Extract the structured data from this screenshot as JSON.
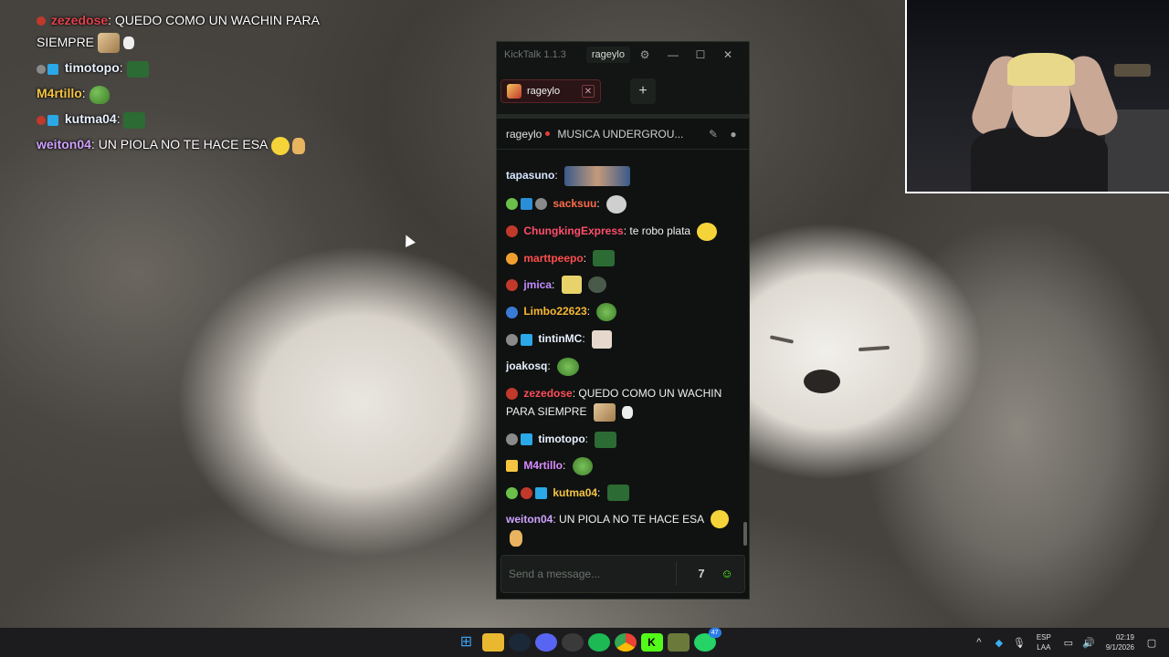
{
  "overlay_chat": [
    {
      "user": "zezedose",
      "user_color": "#e2424e",
      "text": "QUEDO COMO UN WACHIN PARA SIEMPRE"
    },
    {
      "user": "timotopo",
      "user_color": "#e8f0ff",
      "text": ""
    },
    {
      "user": "M4rtillo",
      "user_color": "#f5c542",
      "text": ""
    },
    {
      "user": "kutma04",
      "user_color": "#e8f0ff",
      "text": ""
    },
    {
      "user": "weiton04",
      "user_color": "#cfa2ff",
      "text": "UN PIOLA NO TE HACE ESA"
    }
  ],
  "kicktalk": {
    "app_title": "KickTalk 1.1.3",
    "current_user": "rageylo",
    "tab_label": "rageylo",
    "add_tab_label": "+",
    "channel_name": "rageylo",
    "stream_title": "MUSICA UNDERGROU...",
    "input_placeholder": "Send a message...",
    "messages": [
      {
        "user": "tapasuno",
        "user_color": "#d6e4ff",
        "text": ""
      },
      {
        "user": "sacksuu",
        "user_color": "#ff6b4a",
        "text": ""
      },
      {
        "user": "ChungkingExpress",
        "user_color": "#ff4d6d",
        "text": "te robo plata"
      },
      {
        "user": "marttpeepo",
        "user_color": "#ff4d4d",
        "text": ""
      },
      {
        "user": "jmica",
        "user_color": "#c08bff",
        "text": ""
      },
      {
        "user": "Limbo22623",
        "user_color": "#f7b733",
        "text": ""
      },
      {
        "user": "tintinMC",
        "user_color": "#e8f0ff",
        "text": ""
      },
      {
        "user": "joakosq",
        "user_color": "#e8f0ff",
        "text": ""
      },
      {
        "user": "zezedose",
        "user_color": "#ff4d5a",
        "text": "QUEDO COMO UN WACHIN PARA SIEMPRE"
      },
      {
        "user": "timotopo",
        "user_color": "#e8f0ff",
        "text": ""
      },
      {
        "user": "M4rtillo",
        "user_color": "#d98cff",
        "text": ""
      },
      {
        "user": "kutma04",
        "user_color": "#f5c542",
        "text": ""
      },
      {
        "user": "weiton04",
        "user_color": "#cfa2ff",
        "text": "UN PIOLA NO TE HACE ESA"
      }
    ]
  },
  "taskbar": {
    "lang_line1": "ESP",
    "lang_line2": "LAA",
    "time": "02:19",
    "date": "9/1/2026",
    "whatsapp_badge": "47"
  },
  "colors": {
    "kick_green": "#53fc18",
    "window_bg": "#0f1210",
    "tab_bg": "#2a1416"
  }
}
